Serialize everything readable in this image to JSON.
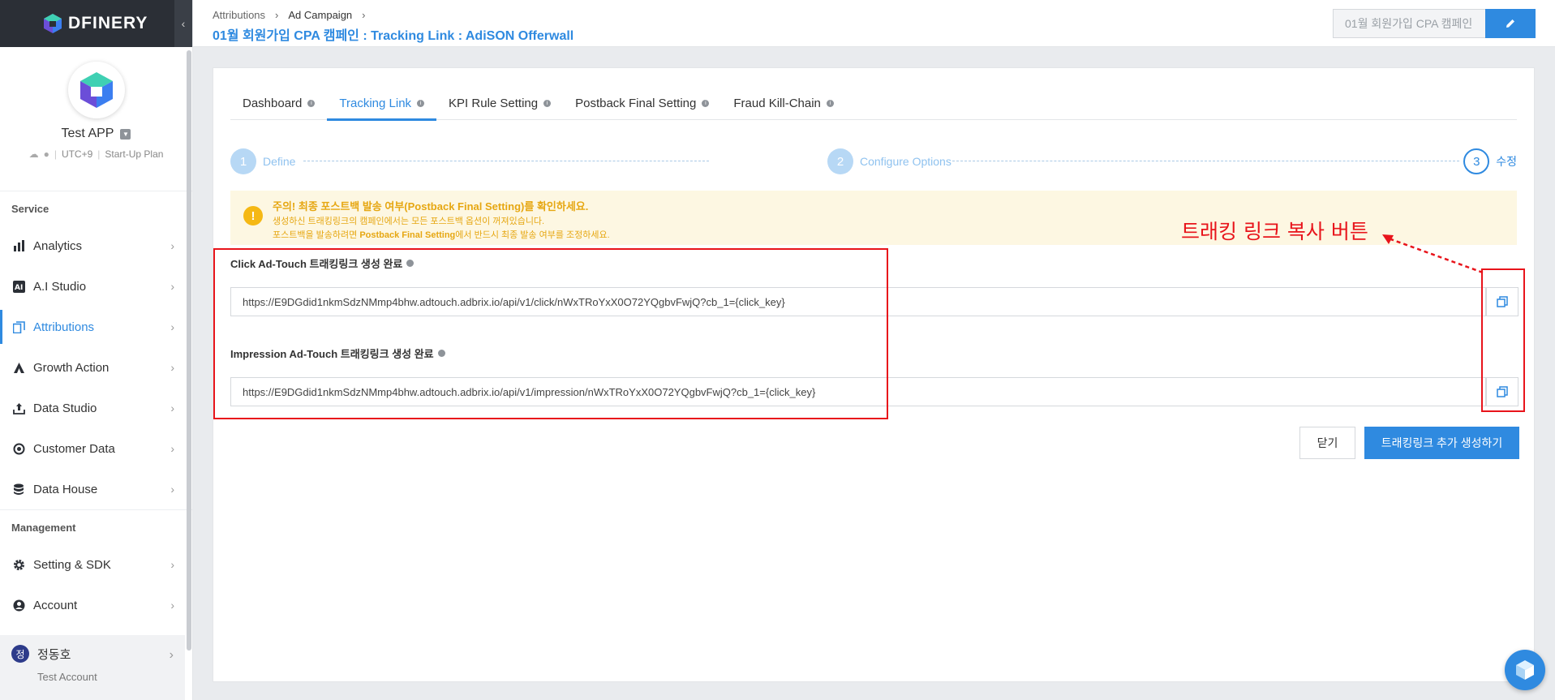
{
  "brand": {
    "name": "DFINERY"
  },
  "app": {
    "name": "Test APP",
    "timezone": "UTC+9",
    "plan": "Start-Up Plan"
  },
  "sidebar": {
    "service_title": "Service",
    "service_items": [
      {
        "label": "Analytics",
        "icon": "bar-chart-icon"
      },
      {
        "label": "A.I Studio",
        "icon": "ai-icon"
      },
      {
        "label": "Attributions",
        "icon": "attribution-icon",
        "active": true
      },
      {
        "label": "Growth Action",
        "icon": "growth-icon"
      },
      {
        "label": "Data Studio",
        "icon": "upload-icon"
      },
      {
        "label": "Customer Data",
        "icon": "target-icon"
      },
      {
        "label": "Data House",
        "icon": "database-icon"
      }
    ],
    "management_title": "Management",
    "management_items": [
      {
        "label": "Setting & SDK",
        "icon": "gear-icon"
      },
      {
        "label": "Account",
        "icon": "user-icon"
      }
    ],
    "user": {
      "initial": "정",
      "name": "정동호",
      "sub": "Test Account"
    }
  },
  "header": {
    "breadcrumb": [
      "Attributions",
      "Ad Campaign"
    ],
    "title": "01월 회원가입 CPA 캠페인 : Tracking Link : AdiSON Offerwall",
    "campaign_input_value": "01월 회원가입 CPA 캠페인"
  },
  "tabs": [
    {
      "label": "Dashboard"
    },
    {
      "label": "Tracking Link",
      "active": true
    },
    {
      "label": "KPI Rule Setting"
    },
    {
      "label": "Postback Final Setting"
    },
    {
      "label": "Fraud Kill-Chain"
    }
  ],
  "steps": [
    {
      "num": "1",
      "label": "Define"
    },
    {
      "num": "2",
      "label": "Configure Options"
    },
    {
      "num": "3",
      "label": "수정",
      "current": true
    }
  ],
  "alert": {
    "title": "주의! 최종 포스트백 발송 여부(Postback Final Setting)를 확인하세요.",
    "line1": "생성하신 트래킹링크의 캠페인에서는 모든 포스트백 옵션이 꺼져있습니다.",
    "line2_pre": "포스트백을 발송하려면 ",
    "line2_bold": "Postback Final Setting",
    "line2_post": "에서 반드시 최종 발송 여부를 조정하세요."
  },
  "links": [
    {
      "label": "Click Ad-Touch 트래킹링크 생성 완료",
      "url": "https://E9DGdid1nkmSdzNMmp4bhw.adtouch.adbrix.io/api/v1/click/nWxTRoYxX0O72YQgbvFwjQ?cb_1={click_key}"
    },
    {
      "label": "Impression Ad-Touch 트래킹링크 생성 완료",
      "url": "https://E9DGdid1nkmSdzNMmp4bhw.adtouch.adbrix.io/api/v1/impression/nWxTRoYxX0O72YQgbvFwjQ?cb_1={click_key}"
    }
  ],
  "actions": {
    "close": "닫기",
    "create_more": "트래킹링크 추가 생성하기"
  },
  "annotation": {
    "text": "트래킹 링크 복사 버튼",
    "color": "#e8141b"
  },
  "colors": {
    "accent": "#2f8ae0",
    "warning": "#f5b814",
    "sidebar_dark": "#2b2f36"
  }
}
